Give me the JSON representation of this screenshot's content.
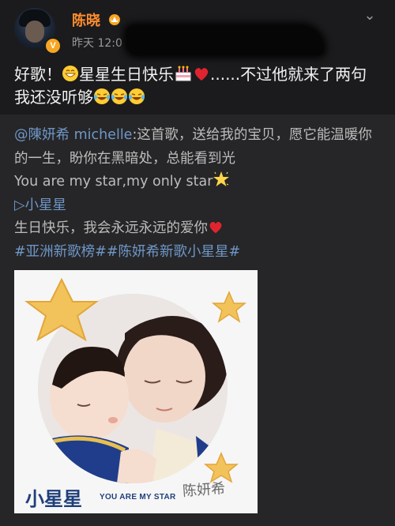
{
  "post": {
    "author": "陈晓",
    "time": "昨天 12:0",
    "text_before": "好歌！",
    "text_mid": "星星生日快乐",
    "text_after": "......不过他就来了两句我还没听够"
  },
  "repost": {
    "mention": "@陳妍希 michelle",
    "line1_text": ":这首歌，送给我的宝贝，愿它能温暖你的一生，盼你在黑暗处，总能看到光",
    "line2": "You are my star,my only star",
    "song_link": "▷小星星",
    "line4": "生日快乐，我会永远永远的爱你",
    "hashtags": "#亚洲新歌榜##陈妍希新歌小星星#"
  },
  "image": {
    "title": "小星星",
    "subtitle": "YOU ARE MY STAR",
    "artist": "陈妍希"
  },
  "colors": {
    "background": "#1b1b1d",
    "repost_background": "#262628",
    "username": "#ff8d2e",
    "link": "#6f97c7"
  },
  "icons": [
    "crown-icon",
    "vip-badge-icon",
    "more-options-icon",
    "grin-emoji",
    "cake-emoji",
    "heart-emoji",
    "laugh-cry-emoji",
    "star-emoji"
  ]
}
